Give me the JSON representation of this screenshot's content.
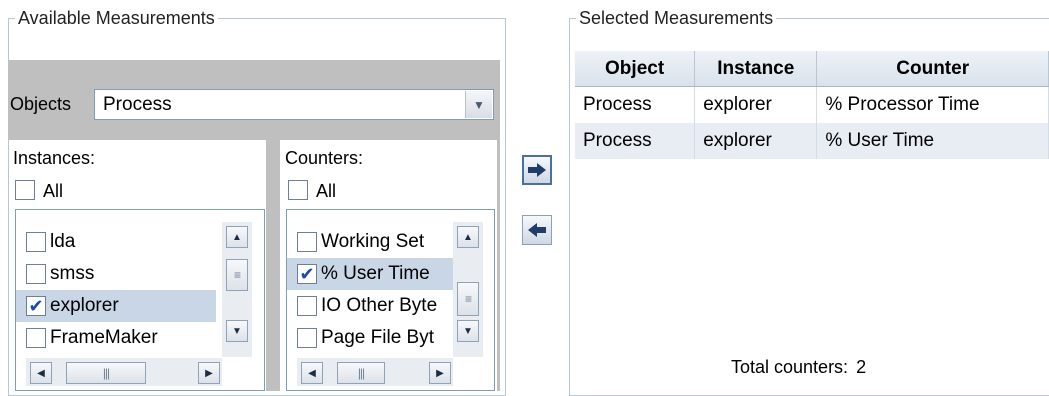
{
  "available": {
    "title": "Available Measurements",
    "objects_label": "Objects",
    "objects_value": "Process",
    "instances": {
      "label": "Instances:",
      "all_label": "All",
      "all_checked": false,
      "items": [
        {
          "label": "lda",
          "checked": false,
          "selected": false
        },
        {
          "label": "smss",
          "checked": false,
          "selected": false
        },
        {
          "label": "explorer",
          "checked": true,
          "selected": true
        },
        {
          "label": "FrameMaker",
          "checked": false,
          "selected": false
        }
      ]
    },
    "counters": {
      "label": "Counters:",
      "all_label": "All",
      "all_checked": false,
      "items": [
        {
          "label": "Working Set",
          "checked": false,
          "selected": false
        },
        {
          "label": "% User Time",
          "checked": true,
          "selected": true
        },
        {
          "label": "IO Other Byte",
          "checked": false,
          "selected": false
        },
        {
          "label": "Page File Byt",
          "checked": false,
          "selected": false
        }
      ]
    }
  },
  "actions": {
    "add_icon": "arrow-right-icon",
    "remove_icon": "arrow-left-icon"
  },
  "selected": {
    "title": "Selected Measurements",
    "columns": [
      "Object",
      "Instance",
      "Counter"
    ],
    "rows": [
      [
        "Process",
        "explorer",
        "% Processor Time"
      ],
      [
        "Process",
        "explorer",
        "% User Time"
      ]
    ],
    "total_label": "Total counters:",
    "total_value": "2"
  },
  "colors": {
    "selection": "#c9d6e6",
    "border": "#b8c7d6",
    "check": "#1a49b0",
    "objects_bar": "#bfbfbf"
  }
}
